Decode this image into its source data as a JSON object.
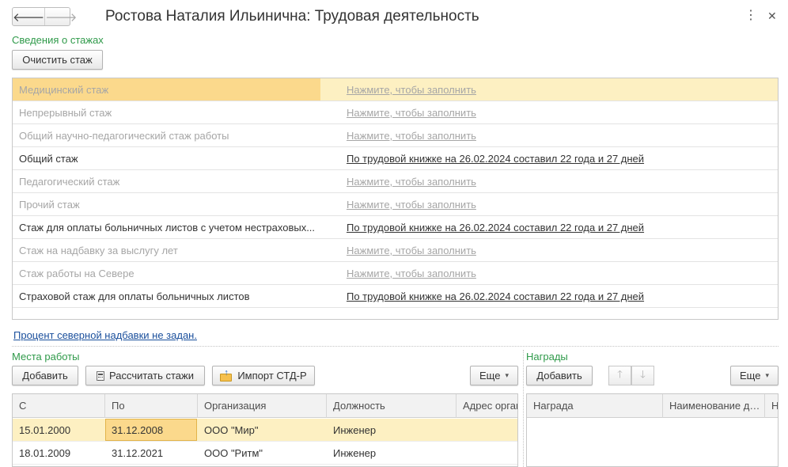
{
  "header": {
    "back_icon": "arrow-left-icon",
    "forward_icon": "arrow-right-icon",
    "title": "Ростова Наталия Ильинична: Трудовая деятельность"
  },
  "stazh": {
    "section_label": "Сведения о стажах",
    "clear_button": "Очистить стаж",
    "rows": [
      {
        "name": "Медицинский стаж",
        "value": "Нажмите, чтобы заполнить",
        "filled": false,
        "selected": true
      },
      {
        "name": "Непрерывный стаж",
        "value": "Нажмите, чтобы заполнить",
        "filled": false,
        "selected": false
      },
      {
        "name": "Общий научно-педагогический стаж работы",
        "value": "Нажмите, чтобы заполнить",
        "filled": false,
        "selected": false
      },
      {
        "name": "Общий стаж",
        "value": "По трудовой книжке на 26.02.2024 составил 22 года и 27 дней",
        "filled": true,
        "selected": false
      },
      {
        "name": "Педагогический стаж",
        "value": "Нажмите, чтобы заполнить",
        "filled": false,
        "selected": false
      },
      {
        "name": "Прочий стаж",
        "value": "Нажмите, чтобы заполнить",
        "filled": false,
        "selected": false
      },
      {
        "name": "Стаж для оплаты больничных листов с учетом нестраховых...",
        "value": "По трудовой книжке на 26.02.2024 составил 22 года и 27 дней",
        "filled": true,
        "selected": false
      },
      {
        "name": "Стаж на надбавку за выслугу лет",
        "value": "Нажмите, чтобы заполнить",
        "filled": false,
        "selected": false
      },
      {
        "name": "Стаж работы на Севере",
        "value": "Нажмите, чтобы заполнить",
        "filled": false,
        "selected": false
      },
      {
        "name": "Страховой стаж для оплаты больничных листов",
        "value": "По трудовой книжке на 26.02.2024 составил 22 года и 27 дней",
        "filled": true,
        "selected": false
      }
    ],
    "northern_link": "Процент северной надбавки не задан."
  },
  "workplaces": {
    "label": "Места работы",
    "add_button": "Добавить",
    "calc_button": "Рассчитать стажи",
    "import_button": "Импорт СТД-Р",
    "more_button": "Еще",
    "columns": [
      "С",
      "По",
      "Организация",
      "Должность",
      "Адрес организации"
    ],
    "rows": [
      [
        "15.01.2000",
        "31.12.2008",
        "ООО \"Мир\"",
        "Инженер",
        ""
      ],
      [
        "18.01.2009",
        "31.12.2021",
        "ООО \"Ритм\"",
        "Инженер",
        ""
      ]
    ]
  },
  "awards": {
    "label": "Награды",
    "add_button": "Добавить",
    "up_icon": "arrow-up-icon",
    "down_icon": "arrow-down-icon",
    "more_button": "Еще",
    "columns": [
      "Награда",
      "Наименование документа",
      "Номер"
    ]
  },
  "colors": {
    "section_green": "#2f9a4a",
    "selection_bg": "#fdf0c2",
    "selection_cell": "#fbd98c",
    "link_blue": "#1a4f9c"
  }
}
